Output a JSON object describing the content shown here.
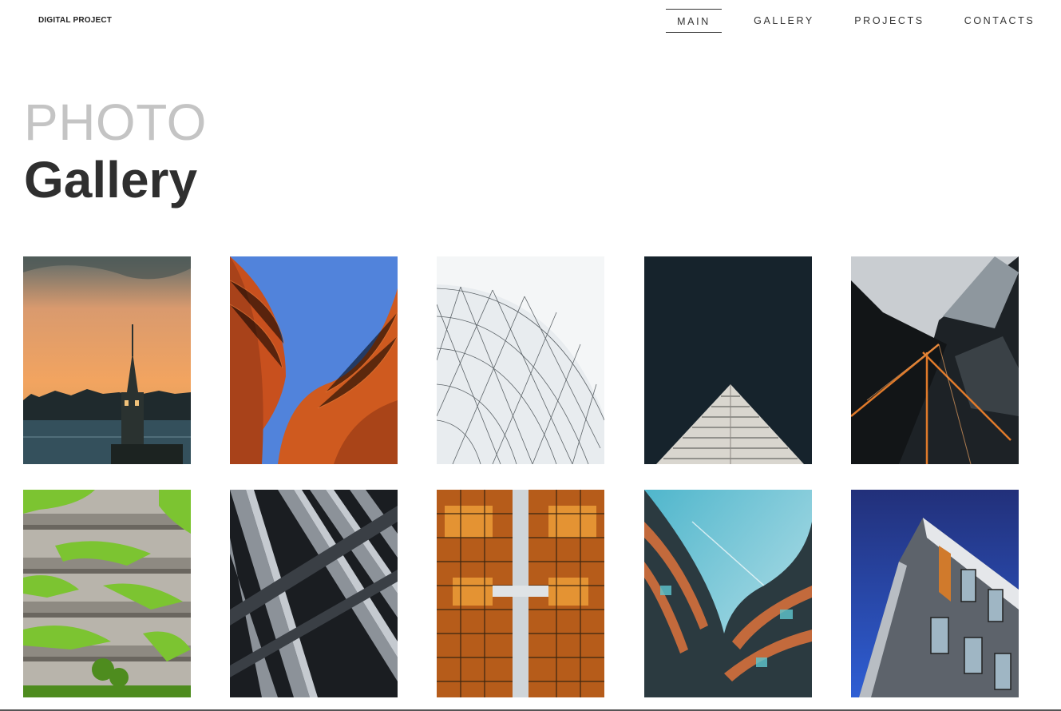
{
  "header": {
    "brand": "DIGITAL PROJECT",
    "nav": [
      {
        "label": "MAIN",
        "active": true
      },
      {
        "label": "GALLERY",
        "active": false
      },
      {
        "label": "PROJECTS",
        "active": false
      },
      {
        "label": "CONTACTS",
        "active": false
      }
    ]
  },
  "hero": {
    "line1": "PHOTO",
    "line2": "Gallery"
  },
  "colors": {
    "heading_light": "#c4c4c4",
    "heading_dark": "#2f2f2f",
    "nav_text": "#333333"
  },
  "gallery": [
    {
      "subject": "sunset-tower-photo"
    },
    {
      "subject": "orange-curved-facade-photo"
    },
    {
      "subject": "white-glass-dome-photo"
    },
    {
      "subject": "dark-sky-triangle-building-photo"
    },
    {
      "subject": "skyscrapers-upward-photo"
    },
    {
      "subject": "green-terrace-building-photo"
    },
    {
      "subject": "dark-angular-facade-photo"
    },
    {
      "subject": "mirrored-glass-towers-photo"
    },
    {
      "subject": "curved-glass-building-photo"
    },
    {
      "subject": "blue-sky-corner-building-photo"
    }
  ]
}
